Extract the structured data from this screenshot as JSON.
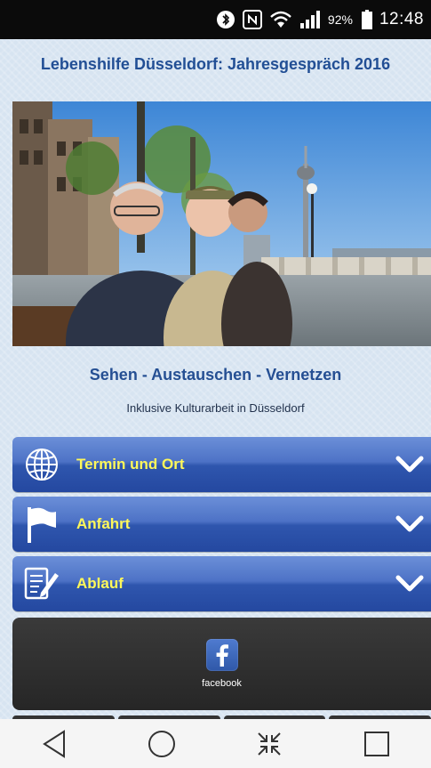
{
  "status_bar": {
    "icons": [
      "bluetooth-icon",
      "nfc-icon",
      "wifi-icon",
      "signal-icon",
      "battery-icon"
    ],
    "battery_text": "92%",
    "time": "12:48"
  },
  "page": {
    "title": "Lebenshilfe Düsseldorf: Jahresgespräch 2016",
    "hero_image": "photo-three-men-rhine-promenade",
    "slogan": "Sehen - Austauschen - Vernetzen",
    "subline": "Inklusive Kulturarbeit in Düsseldorf",
    "sections": [
      {
        "label": "Termin und Ort",
        "icon": "globe-icon"
      },
      {
        "label": "Anfahrt",
        "icon": "flag-icon"
      },
      {
        "label": "Ablauf",
        "icon": "document-edit-icon"
      }
    ],
    "social": {
      "icon": "facebook-icon",
      "label": "facebook"
    }
  },
  "colors": {
    "title": "#224f95",
    "accordion_label": "#fff85a",
    "accordion_dark": "#2448a0",
    "accordion_light": "#6b8fd8",
    "page_bg": "#d7e4f1"
  },
  "nav_bar": {
    "buttons": [
      "back-icon",
      "home-icon",
      "minimize-icon",
      "recent-apps-icon"
    ]
  }
}
